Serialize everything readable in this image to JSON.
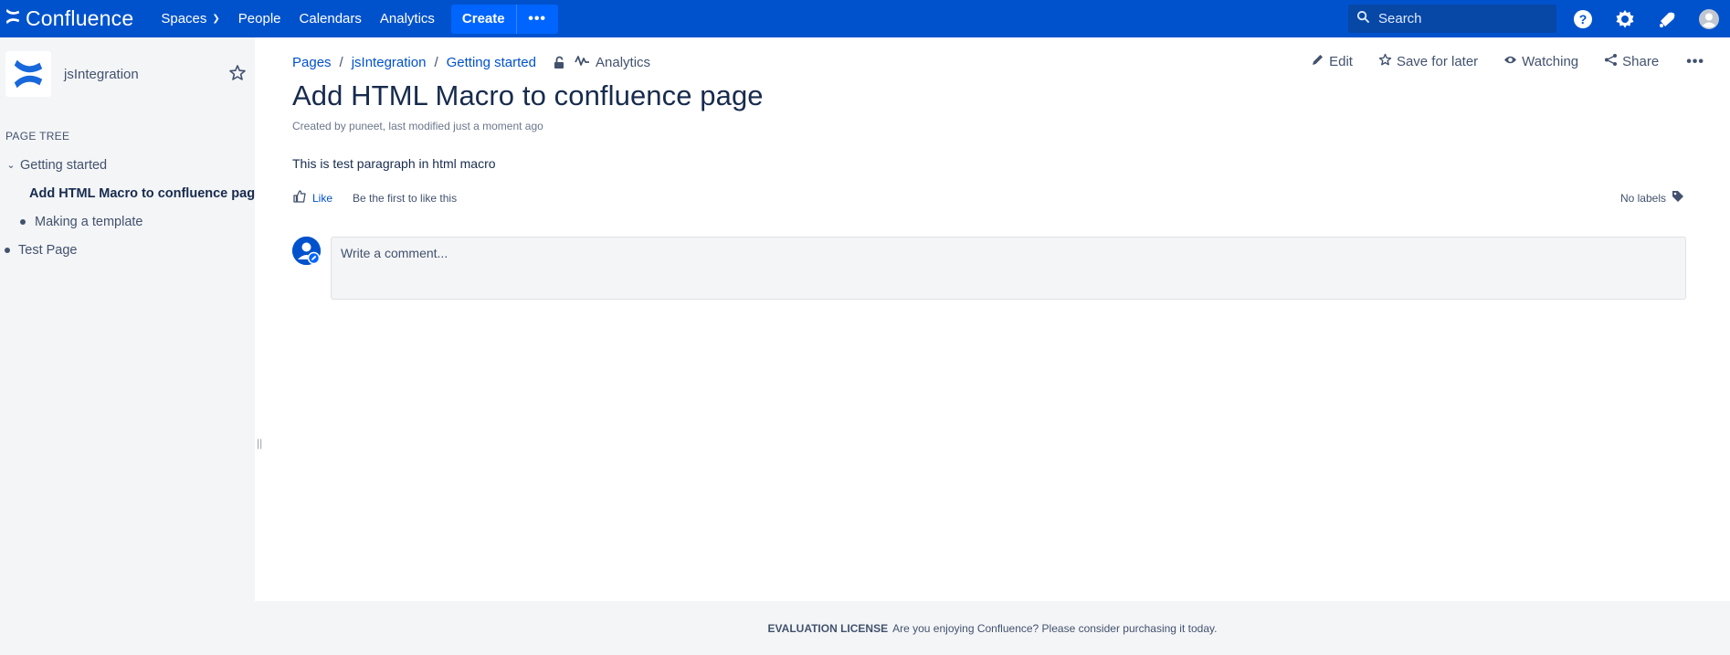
{
  "topnav": {
    "brand": "Confluence",
    "links": [
      {
        "label": "Spaces",
        "has_caret": true
      },
      {
        "label": "People"
      },
      {
        "label": "Calendars"
      },
      {
        "label": "Analytics"
      }
    ],
    "create_label": "Create",
    "more_label": "•••",
    "search_placeholder": "Search",
    "icons": [
      "help-icon",
      "settings-icon",
      "notifications-icon",
      "user-avatar-icon"
    ],
    "bg_color": "#0052cc"
  },
  "sidebar": {
    "space_name": "jsIntegration",
    "page_tree_title": "PAGE TREE",
    "tree": [
      {
        "label": "Getting started",
        "level": 0,
        "expanded": true
      },
      {
        "label": "Add HTML Macro to confluence page",
        "level": 1,
        "current": true
      },
      {
        "label": "Making a template",
        "level": 1
      },
      {
        "label": "Test Page",
        "level": 0
      }
    ],
    "resizer_glyph": "||"
  },
  "breadcrumbs": {
    "items": [
      "Pages",
      "jsIntegration",
      "Getting started"
    ],
    "analytics_label": "Analytics"
  },
  "page_actions": {
    "edit": "Edit",
    "save_for_later": "Save for later",
    "watching": "Watching",
    "share": "Share",
    "more": "•••"
  },
  "page": {
    "title": "Add HTML Macro to confluence page",
    "byline": "Created by puneet, last modified just a moment ago",
    "body": "This is test paragraph in html macro",
    "like_label": "Like",
    "like_hint": "Be the first to like this",
    "labels_text": "No labels",
    "comment_placeholder": "Write a comment..."
  },
  "footer": {
    "license": "EVALUATION LICENSE",
    "message": "Are you enjoying Confluence? Please consider purchasing it today."
  }
}
